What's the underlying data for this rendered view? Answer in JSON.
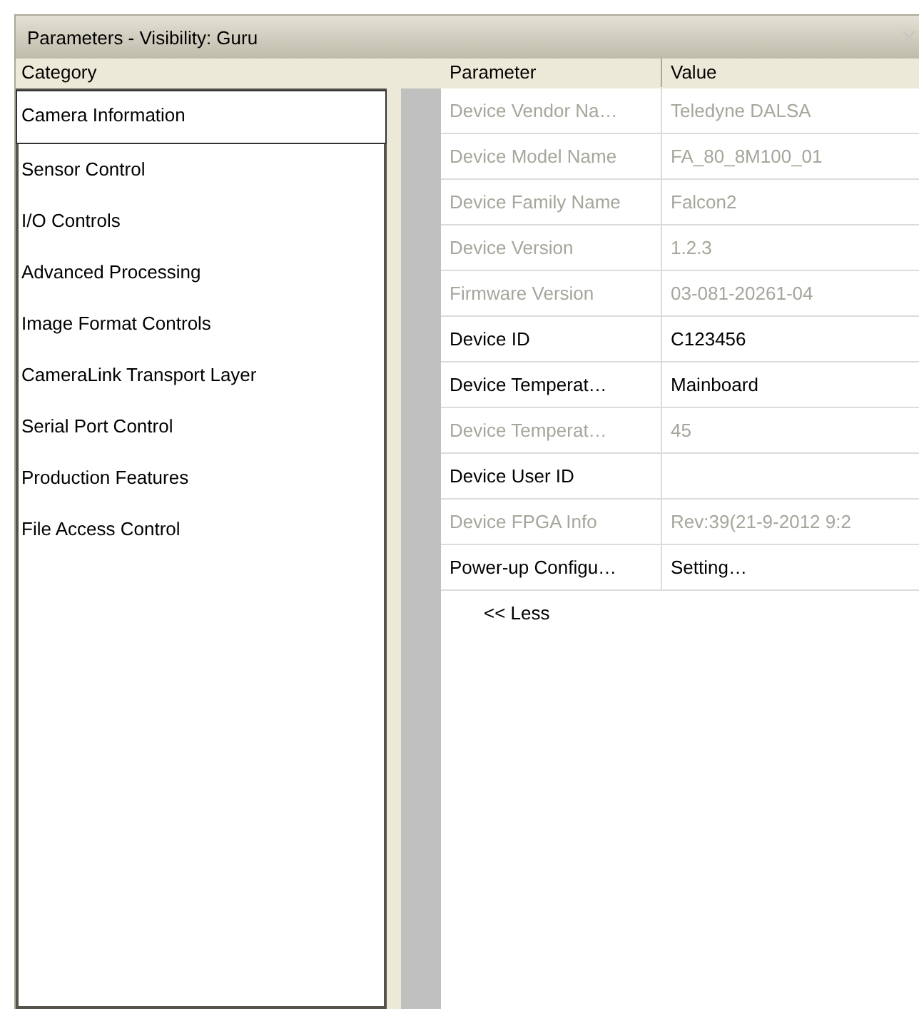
{
  "window": {
    "title": "Parameters - Visibility: Guru"
  },
  "category": {
    "header": "Category",
    "items": [
      {
        "label": "Camera Information",
        "selected": true
      },
      {
        "label": "Sensor Control",
        "selected": false
      },
      {
        "label": "I/O Controls",
        "selected": false
      },
      {
        "label": "Advanced Processing",
        "selected": false
      },
      {
        "label": "Image Format Controls",
        "selected": false
      },
      {
        "label": "CameraLink Transport Layer",
        "selected": false
      },
      {
        "label": "Serial Port Control",
        "selected": false
      },
      {
        "label": "Production Features",
        "selected": false
      },
      {
        "label": "File Access Control",
        "selected": false
      }
    ]
  },
  "table": {
    "columns": [
      "Parameter",
      "Value"
    ],
    "rows": [
      {
        "parameter": "Device Vendor Na…",
        "value": "Teledyne DALSA",
        "disabled": true
      },
      {
        "parameter": "Device Model Name",
        "value": "FA_80_8M100_01",
        "disabled": true
      },
      {
        "parameter": "Device Family Name",
        "value": "Falcon2",
        "disabled": true
      },
      {
        "parameter": "Device Version",
        "value": "1.2.3",
        "disabled": true
      },
      {
        "parameter": "Firmware Version",
        "value": "03-081-20261-04",
        "disabled": true
      },
      {
        "parameter": "Device ID",
        "value": "C123456",
        "disabled": false
      },
      {
        "parameter": "Device Temperat…",
        "value": "Mainboard",
        "disabled": false
      },
      {
        "parameter": "Device Temperat…",
        "value": "45",
        "disabled": true
      },
      {
        "parameter": "Device User ID",
        "disabled": false
      },
      {
        "parameter": "Device FPGA Info",
        "value": "Rev:39(21-9-2012 9:2",
        "disabled": true
      },
      {
        "parameter": "Power-up Configu…",
        "value": "Setting…",
        "disabled": false
      }
    ]
  },
  "less_button": "<< Less"
}
